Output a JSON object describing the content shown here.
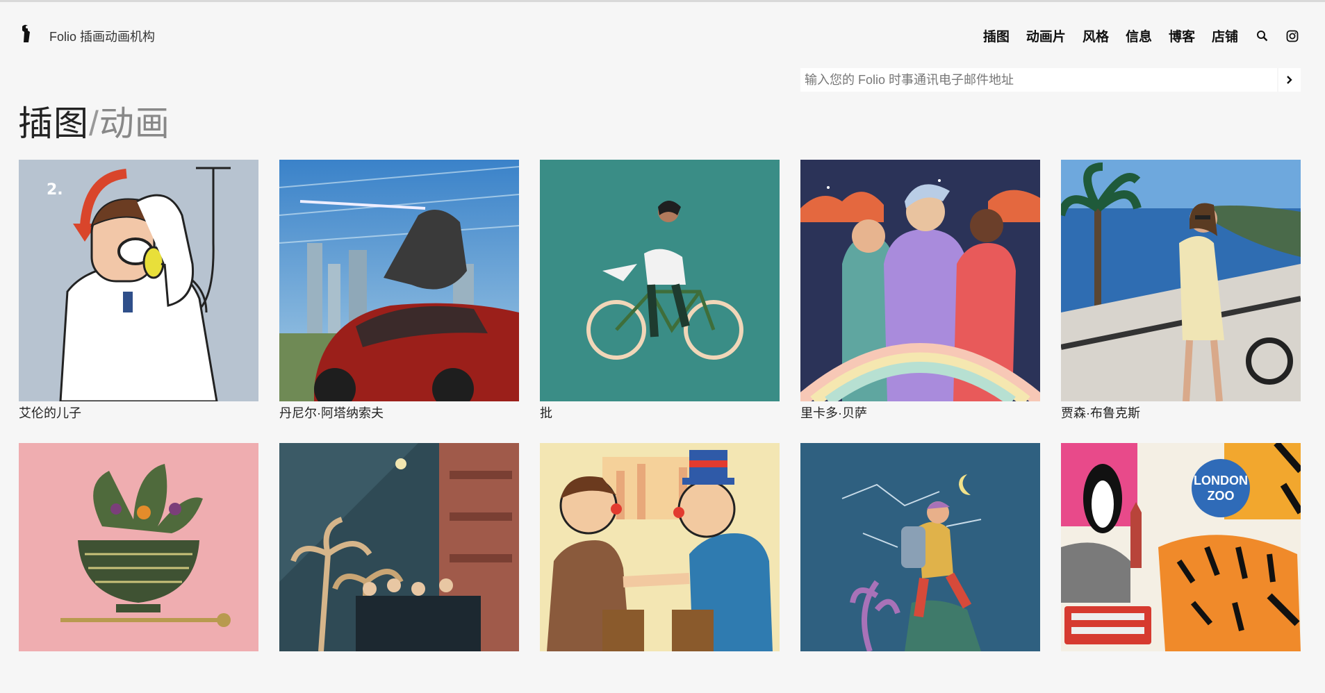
{
  "brand": {
    "name": "Folio 插画动画机构"
  },
  "nav": {
    "items": [
      {
        "label": "插图"
      },
      {
        "label": "动画片"
      },
      {
        "label": "风格"
      },
      {
        "label": "信息"
      },
      {
        "label": "博客"
      },
      {
        "label": "店铺"
      }
    ],
    "icons": [
      "search-icon",
      "instagram-icon"
    ]
  },
  "newsletter": {
    "placeholder": "输入您的 Folio 时事通讯电子邮件地址",
    "submit_icon": "chevron-right-icon"
  },
  "heading": {
    "primary": "插图",
    "separator": "/",
    "secondary": "动画"
  },
  "gallery": {
    "row1": [
      {
        "caption": "艾伦的儿子"
      },
      {
        "caption": "丹尼尔·阿塔纳索夫"
      },
      {
        "caption": "批"
      },
      {
        "caption": "里卡多·贝萨"
      },
      {
        "caption": "贾森·布鲁克斯"
      }
    ],
    "row2": [
      {
        "caption": ""
      },
      {
        "caption": ""
      },
      {
        "caption": ""
      },
      {
        "caption": ""
      },
      {
        "caption": "",
        "art_text": [
          "LONDON",
          "ZOO"
        ]
      }
    ]
  },
  "colors": {
    "background": "#f6f6f6",
    "text": "#111111",
    "secondary_text": "#888888"
  }
}
